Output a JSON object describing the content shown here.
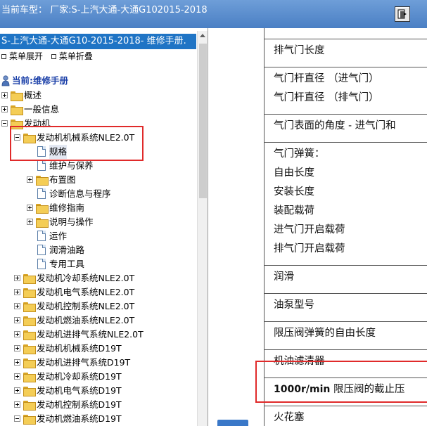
{
  "window": {
    "title": "当前车型：  厂家:S-上汽大通-大通G102015-2018",
    "corner_button_icon": "exit-icon"
  },
  "sidebar": {
    "manual_title": "S-上汽大通-大通G10-2015-2018- 维修手册.",
    "expand_all": "菜单展开",
    "collapse_all": "菜单折叠",
    "root_label": "当前:维修手册",
    "tree": [
      {
        "label": "概述",
        "level": 0,
        "type": "folder",
        "expander": "plus"
      },
      {
        "label": "一般信息",
        "level": 0,
        "type": "folder",
        "expander": "plus"
      },
      {
        "label": "发动机",
        "level": 0,
        "type": "folder",
        "expander": "minus"
      },
      {
        "label": "发动机机械系统NLE2.0T",
        "level": 1,
        "type": "folder",
        "expander": "minus"
      },
      {
        "label": "规格",
        "level": 2,
        "type": "doc",
        "selected": true
      },
      {
        "label": "维护与保养",
        "level": 2,
        "type": "doc"
      },
      {
        "label": "布置图",
        "level": 2,
        "type": "folder",
        "expander": "plus"
      },
      {
        "label": "诊断信息与程序",
        "level": 2,
        "type": "doc"
      },
      {
        "label": "维修指南",
        "level": 2,
        "type": "folder",
        "expander": "plus"
      },
      {
        "label": "说明与操作",
        "level": 2,
        "type": "folder",
        "expander": "plus"
      },
      {
        "label": "运作",
        "level": 2,
        "type": "doc"
      },
      {
        "label": "润滑油路",
        "level": 2,
        "type": "doc"
      },
      {
        "label": "专用工具",
        "level": 2,
        "type": "doc"
      },
      {
        "label": "发动机冷却系统NLE2.0T",
        "level": 1,
        "type": "folder",
        "expander": "plus"
      },
      {
        "label": "发动机电气系统NLE2.0T",
        "level": 1,
        "type": "folder",
        "expander": "plus"
      },
      {
        "label": "发动机控制系统NLE2.0T",
        "level": 1,
        "type": "folder",
        "expander": "plus"
      },
      {
        "label": "发动机燃油系统NLE2.0T",
        "level": 1,
        "type": "folder",
        "expander": "plus"
      },
      {
        "label": "发动机进排气系统NLE2.0T",
        "level": 1,
        "type": "folder",
        "expander": "plus"
      },
      {
        "label": "发动机机械系统D19T",
        "level": 1,
        "type": "folder",
        "expander": "plus"
      },
      {
        "label": "发动机进排气系统D19T",
        "level": 1,
        "type": "folder",
        "expander": "plus"
      },
      {
        "label": "发动机冷却系统D19T",
        "level": 1,
        "type": "folder",
        "expander": "plus"
      },
      {
        "label": "发动机电气系统D19T",
        "level": 1,
        "type": "folder",
        "expander": "plus"
      },
      {
        "label": "发动机控制系统D19T",
        "level": 1,
        "type": "folder",
        "expander": "plus"
      },
      {
        "label": "发动机燃油系统D19T",
        "level": 1,
        "type": "folder",
        "expander": "minus"
      }
    ]
  },
  "content": {
    "rows": [
      {
        "lines": [
          "排气门长度"
        ]
      },
      {
        "lines": [
          "气门杆直径 （进气门）",
          "气门杆直径 （排气门）"
        ]
      },
      {
        "lines": [
          "气门表面的角度 - 进气门和"
        ]
      },
      {
        "lines": [
          "气门弹簧：",
          "自由长度",
          "安装长度",
          "装配载荷",
          "进气门开启载荷",
          "排气门开启载荷"
        ]
      },
      {
        "lines": [
          "润滑"
        ]
      },
      {
        "lines": [
          "油泵型号"
        ]
      },
      {
        "lines": [
          "限压阀弹簧的自由长度"
        ]
      },
      {
        "lines": [
          "机油滤清器"
        ]
      },
      {
        "lines": [
          "1000r/min 限压阀的截止压"
        ]
      },
      {
        "lines": [
          "火花塞"
        ]
      }
    ]
  },
  "colors": {
    "title_bar": "#4a7fc4",
    "manual_title_bg": "#1f74c5",
    "highlight_box": "#e02a2a",
    "root_text": "#1a3fa8"
  }
}
